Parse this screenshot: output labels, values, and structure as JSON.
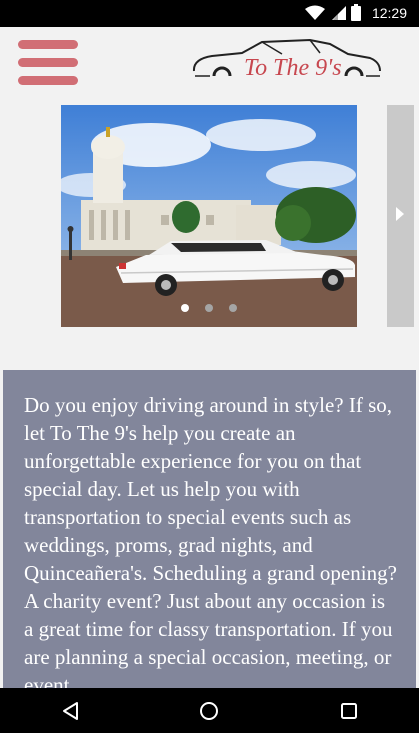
{
  "status_bar": {
    "time": "12:29",
    "icons": [
      "wifi-icon",
      "cell-signal-icon",
      "battery-icon"
    ]
  },
  "header": {
    "menu_icon": "hamburger-menu-icon",
    "logo_text": "To The 9's"
  },
  "carousel": {
    "slide_count": 3,
    "active_index": 0,
    "next_icon": "chevron-right-icon"
  },
  "content": {
    "intro": "Do you enjoy driving around in style? If so, let To The 9's help you create an unforgettable experience for you on that special day. Let us help you with transportation to special events such as weddings, proms, grad nights, and Quinceañera's. Scheduling a grand opening? A charity event? Just about any occasion is a great time for classy transportation. If you are planning a special occasion, meeting, or event,"
  },
  "nav_bar": {
    "icons": [
      "back-icon",
      "home-icon",
      "recents-icon"
    ]
  },
  "colors": {
    "accent": "#d16e75",
    "logo_red": "#c7474f",
    "content_bg": "#82869b"
  }
}
